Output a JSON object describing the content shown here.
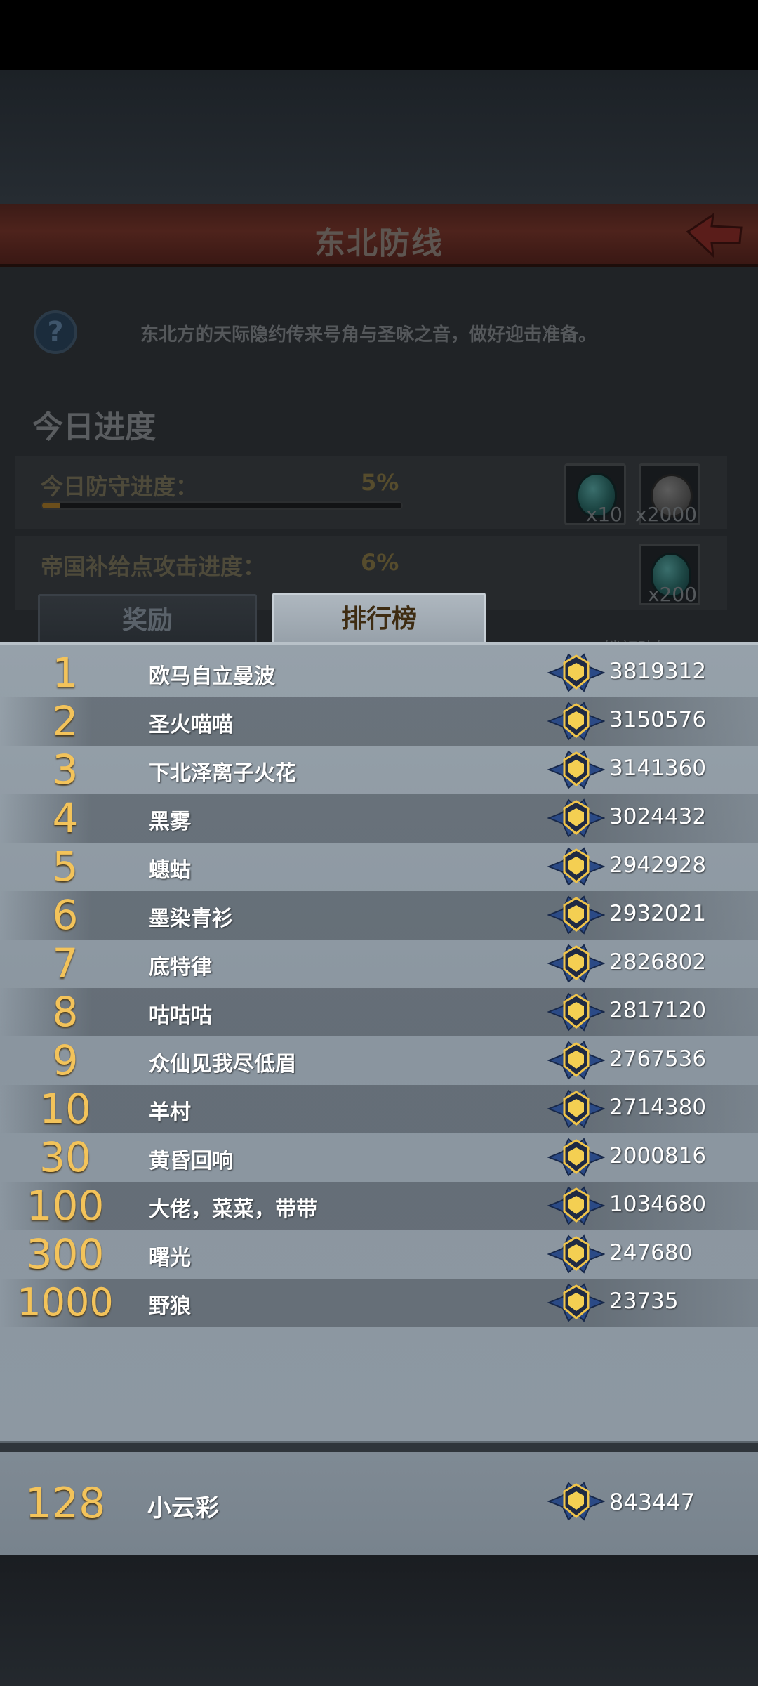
{
  "header": {
    "title": "东北防线"
  },
  "description": "东北方的天际隐约传来号角与圣咏之音，做好迎击准备。",
  "today_progress": {
    "section_title": "今日进度",
    "rows": [
      {
        "label": "今日防守进度：",
        "percent_text": "5%",
        "fill": 0.05,
        "rewards": [
          {
            "icon": "teal-gem-icon",
            "count": "x10"
          },
          {
            "icon": "silver-coin-icon",
            "count": "x2000"
          }
        ]
      },
      {
        "label": "帝国补给点攻击进度：",
        "percent_text": "6%",
        "fill": 0.06,
        "rewards": [
          {
            "icon": "teal-gem-icon",
            "count": "x200"
          }
        ]
      }
    ]
  },
  "tabs": [
    {
      "label": "奖励",
      "active": false
    },
    {
      "label": "排行榜",
      "active": true
    }
  ],
  "partial_text": "锁额助气",
  "leaderboard": [
    {
      "rank": "1",
      "name": "欧马自立曼波",
      "score": "3819312"
    },
    {
      "rank": "2",
      "name": "圣火喵喵",
      "score": "3150576"
    },
    {
      "rank": "3",
      "name": "下北泽离子火花",
      "score": "3141360"
    },
    {
      "rank": "4",
      "name": "黑雾",
      "score": "3024432"
    },
    {
      "rank": "5",
      "name": "蟪蛄",
      "score": "2942928"
    },
    {
      "rank": "6",
      "name": "墨染青衫",
      "score": "2932021"
    },
    {
      "rank": "7",
      "name": "底特律",
      "score": "2826802"
    },
    {
      "rank": "8",
      "name": "咕咕咕",
      "score": "2817120"
    },
    {
      "rank": "9",
      "name": "众仙见我尽低眉",
      "score": "2767536"
    },
    {
      "rank": "10",
      "name": "羊村",
      "score": "2714380"
    },
    {
      "rank": "30",
      "name": "黄昏回响",
      "score": "2000816"
    },
    {
      "rank": "100",
      "name": "大佬，菜菜，带带",
      "score": "1034680"
    },
    {
      "rank": "300",
      "name": "曙光",
      "score": "247680"
    },
    {
      "rank": "1000",
      "name": "野狼",
      "score": "23735"
    }
  ],
  "self": {
    "rank": "128",
    "name": "小云彩",
    "score": "843447"
  },
  "colors": {
    "rank_gold": "#f3c35a",
    "title_bar": "#4e231c",
    "panel": "#8f9aa4"
  }
}
